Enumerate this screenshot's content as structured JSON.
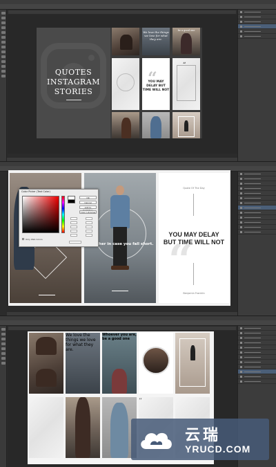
{
  "panel1": {
    "design": {
      "title_lines": [
        "QUOTES",
        "INSTAGRAM",
        "STORIES"
      ],
      "thumb_texts": {
        "we_love": "We love the things we love for what they are.",
        "you_may_delay": "YOU MAY DELAY BUT TIME WILL NOT",
        "be_good": "be a good one"
      }
    }
  },
  "panel2": {
    "stories": {
      "middle_text": "m higher in case you fall short.",
      "right_top": "Quote Of The Day",
      "right_main_lines": [
        "YOU MAY DELAY",
        "BUT TIME WILL NOT"
      ],
      "right_author": "Benjamin Franklin"
    },
    "color_picker": {
      "title": "Color Picker (Text Color)",
      "buttons": [
        "OK",
        "Cancel",
        "Add to Swatches",
        "Color Libraries"
      ],
      "only_web_colors": "Only Web Colors"
    }
  },
  "panel3": {
    "texts": {
      "we_love": "We love the things we love for what they are.",
      "whoever": "Whoever you are, be a good one"
    }
  },
  "watermark": {
    "chinese": "云瑞",
    "domain": "YRUCD.COM"
  },
  "colors": {
    "ps_dark": "#2b2b2b",
    "ps_panel": "#3c3c3c",
    "watermark_bg": "#465a78"
  }
}
